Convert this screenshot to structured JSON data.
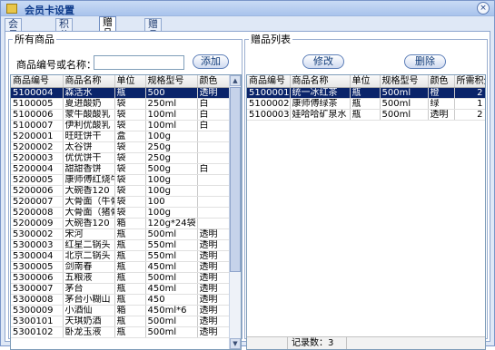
{
  "window": {
    "title": "会员卡设置",
    "close_glyph": "×"
  },
  "tabs": [
    "会员卡设置",
    "积分设置",
    "赠品设置",
    "赠品查询"
  ],
  "left": {
    "legend": "所有商品",
    "search_label": "商品编号或名称：",
    "search_value": "",
    "add_label": "添加",
    "columns": [
      "商品编号",
      "商品名称",
      "单位",
      "规格型号",
      "颜色"
    ],
    "rows": [
      [
        "5100004",
        "森活水",
        "瓶",
        "500",
        "透明"
      ],
      [
        "5100005",
        "夏进酸奶",
        "袋",
        "250ml",
        "白"
      ],
      [
        "5100006",
        "蒙牛酸酸乳",
        "袋",
        "100ml",
        "白"
      ],
      [
        "5100007",
        "伊利优酸乳",
        "袋",
        "100ml",
        "白"
      ],
      [
        "5200001",
        "旺旺饼干",
        "盒",
        "100g",
        ""
      ],
      [
        "5200002",
        "太谷饼",
        "袋",
        "250g",
        ""
      ],
      [
        "5200003",
        "优优饼干",
        "袋",
        "250g",
        ""
      ],
      [
        "5200004",
        "甜甜香饼",
        "袋",
        "500g",
        "白"
      ],
      [
        "5200005",
        "康师傅红烧牛肉",
        "袋",
        "100g",
        ""
      ],
      [
        "5200006",
        "大碗香120",
        "袋",
        "100g",
        ""
      ],
      [
        "5200007",
        "大骨面（牛骨）",
        "袋",
        "100",
        ""
      ],
      [
        "5200008",
        "大骨面（猪骨）",
        "袋",
        "100g",
        ""
      ],
      [
        "5200009",
        "大碗香120",
        "箱",
        "120g*24袋",
        ""
      ],
      [
        "5300002",
        "宋河",
        "瓶",
        "500ml",
        "透明"
      ],
      [
        "5300003",
        "红星二锅头",
        "瓶",
        "550ml",
        "透明"
      ],
      [
        "5300004",
        "北京二锅头",
        "瓶",
        "550ml",
        "透明"
      ],
      [
        "5300005",
        "剑南春",
        "瓶",
        "450ml",
        "透明"
      ],
      [
        "5300006",
        "五粮液",
        "瓶",
        "500ml",
        "透明"
      ],
      [
        "5300007",
        "茅台",
        "瓶",
        "450ml",
        "透明"
      ],
      [
        "5300008",
        "茅台小糊山",
        "瓶",
        "450",
        "透明"
      ],
      [
        "5300009",
        "小酒仙",
        "箱",
        "450ml*6",
        "透明"
      ],
      [
        "5300101",
        "天琪奶酒",
        "瓶",
        "500ml",
        "透明"
      ],
      [
        "5300102",
        "卧龙玉液",
        "瓶",
        "500ml",
        "透明"
      ]
    ]
  },
  "right": {
    "legend": "赠品列表",
    "edit_label": "修改",
    "delete_label": "删除",
    "columns": [
      "商品编号",
      "商品名称",
      "单位",
      "规格型号",
      "颜色",
      "所需积分"
    ],
    "rows": [
      [
        "5100001",
        "统一冰红茶",
        "瓶",
        "500ml",
        "橙",
        "2"
      ],
      [
        "5100002",
        "康师傅绿茶",
        "瓶",
        "500ml",
        "绿",
        "1"
      ],
      [
        "5100003",
        "娃哈哈矿泉水",
        "瓶",
        "500ml",
        "透明",
        "2"
      ]
    ],
    "status": "记录数：3"
  },
  "scroll_up": "▲",
  "scroll_down": "▼"
}
